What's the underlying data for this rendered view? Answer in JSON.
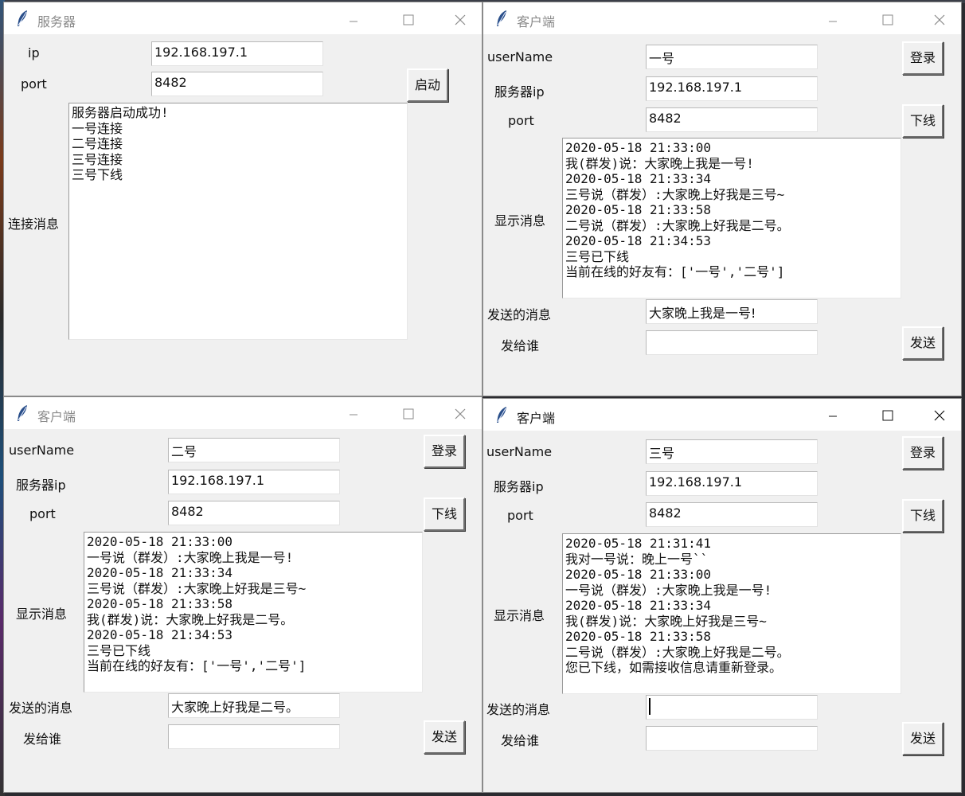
{
  "icons": {
    "app": "feather-icon",
    "minimize": "minimize-icon",
    "maximize": "maximize-icon",
    "close": "close-icon"
  },
  "server": {
    "title": "服务器",
    "ip_label": "ip",
    "ip_value": "192.168.197.1",
    "port_label": "port",
    "port_value": "8482",
    "start_button": "启动",
    "messages_label": "连接消息",
    "messages": [
      "服务器启动成功!",
      "一号连接",
      "二号连接",
      "三号连接",
      "三号下线"
    ]
  },
  "clients": [
    {
      "title": "客户端",
      "username_label": "userName",
      "username_value": "一号",
      "login_button": "登录",
      "server_ip_label": "服务器ip",
      "server_ip_value": "192.168.197.1",
      "port_label": "port",
      "port_value": "8482",
      "offline_button": "下线",
      "display_label": "显示消息",
      "messages": [
        "2020-05-18 21:33:00",
        "我(群发)说：大家晚上我是一号!",
        "2020-05-18 21:33:34",
        "三号说（群发）:大家晚上好我是三号~",
        "2020-05-18 21:33:58",
        "二号说（群发）:大家晚上好我是二号。",
        "2020-05-18 21:34:53",
        "三号已下线",
        "当前在线的好友有：['一号','二号']"
      ],
      "send_msg_label": "发送的消息",
      "send_msg_value": "大家晚上我是一号!",
      "send_to_label": "发给谁",
      "send_to_value": "",
      "send_button": "发送"
    },
    {
      "title": "客户端",
      "username_label": "userName",
      "username_value": "二号",
      "login_button": "登录",
      "server_ip_label": "服务器ip",
      "server_ip_value": "192.168.197.1",
      "port_label": "port",
      "port_value": "8482",
      "offline_button": "下线",
      "display_label": "显示消息",
      "messages": [
        "2020-05-18 21:33:00",
        "一号说（群发）:大家晚上我是一号!",
        "2020-05-18 21:33:34",
        "三号说（群发）:大家晚上好我是三号~",
        "2020-05-18 21:33:58",
        "我(群发)说：大家晚上好我是二号。",
        "2020-05-18 21:34:53",
        "三号已下线",
        "当前在线的好友有：['一号','二号']"
      ],
      "send_msg_label": "发送的消息",
      "send_msg_value": "大家晚上好我是二号。",
      "send_to_label": "发给谁",
      "send_to_value": "",
      "send_button": "发送"
    },
    {
      "title": "客户端",
      "username_label": "userName",
      "username_value": "三号",
      "login_button": "登录",
      "server_ip_label": "服务器ip",
      "server_ip_value": "192.168.197.1",
      "port_label": "port",
      "port_value": "8482",
      "offline_button": "下线",
      "display_label": "显示消息",
      "messages": [
        "2020-05-18 21:31:41",
        "我对一号说：晚上一号``",
        "2020-05-18 21:33:00",
        "一号说（群发）:大家晚上我是一号!",
        "2020-05-18 21:33:34",
        "我(群发)说：大家晚上好我是三号~",
        "2020-05-18 21:33:58",
        "二号说（群发）:大家晚上好我是二号。",
        "您已下线，如需接收信息请重新登录。"
      ],
      "send_msg_label": "发送的消息",
      "send_msg_value": "",
      "send_to_label": "发给谁",
      "send_to_value": "",
      "send_button": "发送"
    }
  ]
}
